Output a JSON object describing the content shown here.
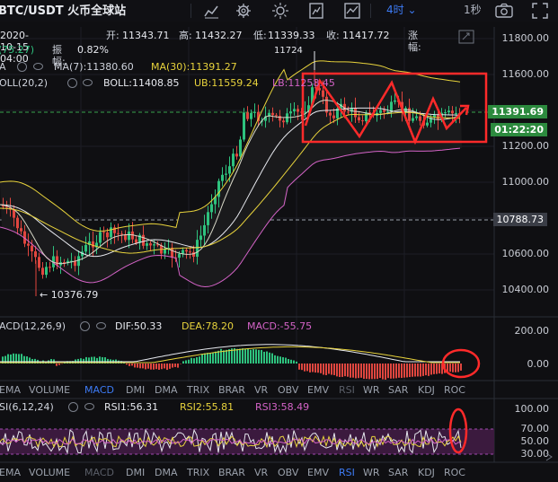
{
  "toolbar": {
    "pair_title": "BTC/USDT 火币全球站",
    "interval_label": "4时 ⌄",
    "interval2_label": "1秒",
    "icons": [
      "candlestick-icon",
      "settings-gear-icon",
      "sun-theme-icon",
      "indicator-icon",
      "trend-chart-icon",
      "camera-icon",
      "fullscreen-icon"
    ]
  },
  "ohlc": {
    "date": "2020-10-15 04:00",
    "open_label": "开:",
    "open": "11343.71",
    "high_label": "高:",
    "high": "11432.27",
    "low_label": "低:",
    "low": "11339.33",
    "close_label": "收:",
    "close": "11417.72",
    "change_label": "涨幅:",
    "change_value": "(75.27)",
    "amplitude_label": "振幅:",
    "amplitude": "0.82%"
  },
  "ma": {
    "prefix": "A",
    "ma7": "MA(7):11380.60",
    "ma30": "MA(30):11391.27"
  },
  "boll": {
    "name": "OLL(20,2)",
    "boll": "BOLL:11408.85",
    "ub": "UB:11559.24",
    "lb": "LB:11258.45"
  },
  "price_axis": {
    "labels": [
      "11800.00",
      "11600.00",
      "11400.00",
      "11200.00",
      "11000.00",
      "10800.00",
      "10600.00",
      "10400.00"
    ],
    "current_price": "11391.69",
    "countdown": "01:22:20",
    "marker_price": "10788.73",
    "high_marker": "11724",
    "low_marker": "← 10376.79"
  },
  "macd": {
    "name": "ACD(12,26,9)",
    "dif": "DIF:50.33",
    "dea": "DEA:78.20",
    "macd": "MACD:-55.75",
    "axis": [
      "200.00",
      "0.00"
    ]
  },
  "rsi": {
    "name": "SI(6,12,24)",
    "rsi1": "RSI1:56.31",
    "rsi2": "RSI2:55.81",
    "rsi3": "RSI3:58.49",
    "axis": [
      "100.00",
      "70.00",
      "50.00",
      "30.00"
    ]
  },
  "tabs_row1": [
    "EMA",
    "VOLUME",
    "MACD",
    "DMI",
    "DMA",
    "TRIX",
    "BRAR",
    "VR",
    "OBV",
    "EMV",
    "RSI",
    "WR",
    "SAR",
    "KDJ",
    "ROC"
  ],
  "tabs_row1_active": "MACD",
  "tabs_row1_dim": "RSI",
  "tabs_row2": [
    "EMA",
    "VOLUME",
    "MACD",
    "DMI",
    "DMA",
    "TRIX",
    "BRAR",
    "VR",
    "OBV",
    "EMV",
    "RSI",
    "WR",
    "SAR",
    "KDJ",
    "ROC"
  ],
  "tabs_row2_active": "RSI",
  "tabs_row2_dim": "MACD",
  "colors": {
    "up": "#2ec27e",
    "down": "#e0463f",
    "accent": "#3d7bf5",
    "yellow": "#e8d33c",
    "pink": "#d463c7",
    "annotation": "#ff2a2a"
  }
}
